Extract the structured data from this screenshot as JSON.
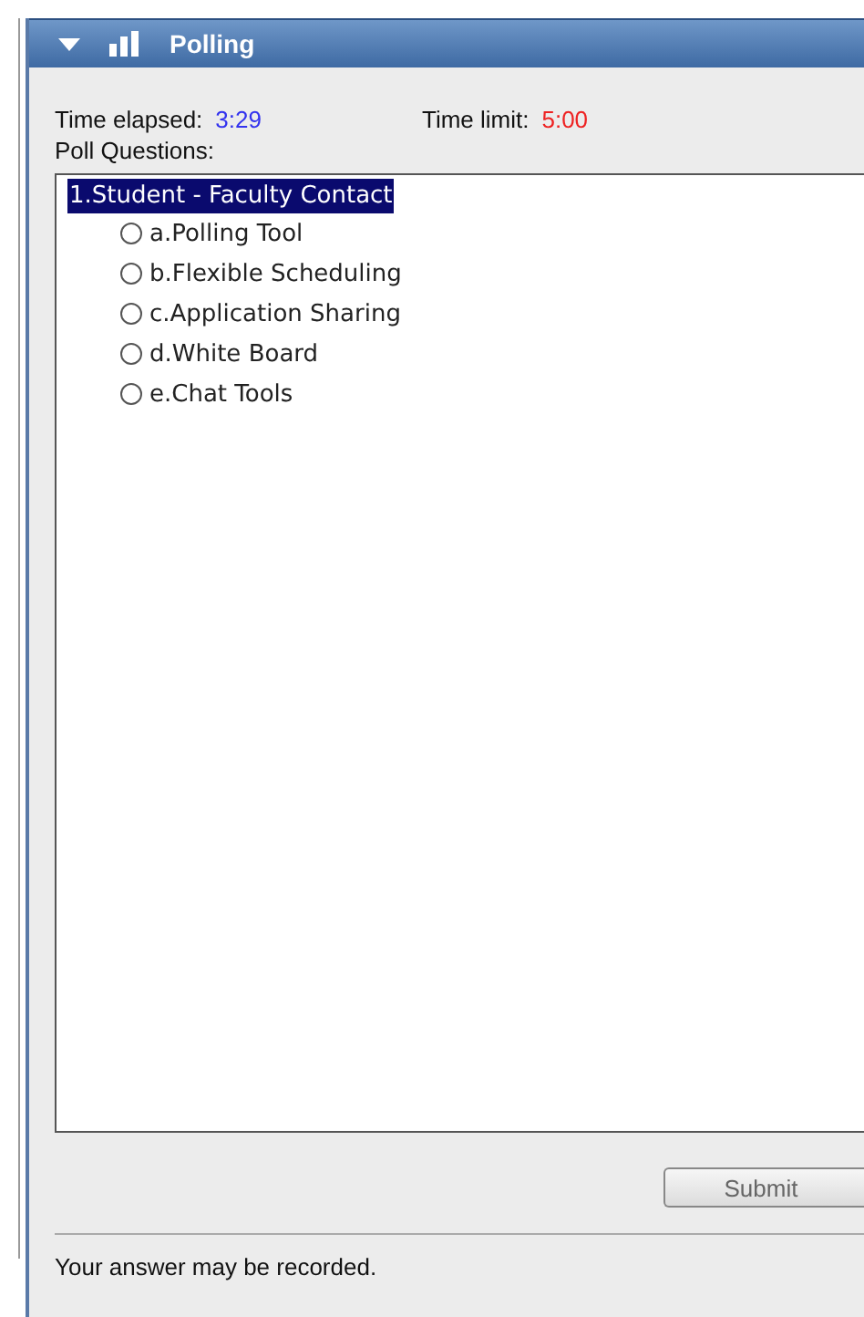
{
  "window": {
    "title": "Polling"
  },
  "timer": {
    "elapsed_label": "Time elapsed:",
    "elapsed": "3:29",
    "limit_label": "Time limit:",
    "limit": "5:00"
  },
  "questions_label": "Poll Questions:",
  "questions": [
    {
      "text": "1.Student - Faculty Contact",
      "selected": true,
      "options": [
        {
          "text": "a.Polling Tool",
          "selected": false
        },
        {
          "text": "b.Flexible Scheduling",
          "selected": false
        },
        {
          "text": "c.Application Sharing",
          "selected": false
        },
        {
          "text": "d.White Board",
          "selected": false
        },
        {
          "text": "e.Chat Tools",
          "selected": false
        }
      ]
    }
  ],
  "submit": {
    "label": "Submit",
    "disabled": true
  },
  "status_bar": "Your answer may be recorded."
}
